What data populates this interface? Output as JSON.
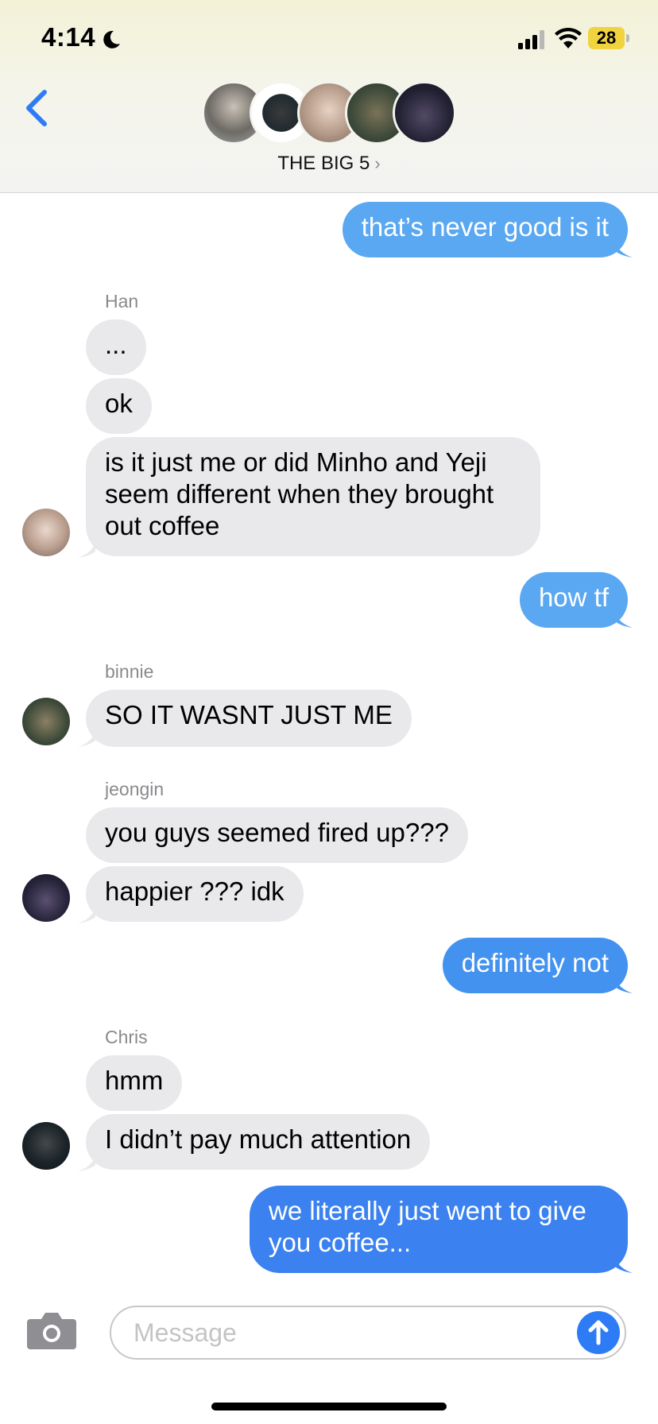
{
  "status_bar": {
    "time": "4:14",
    "battery": "28"
  },
  "header": {
    "group_name": "THE BIG 5",
    "chevron": "›"
  },
  "messages": {
    "m1": "that’s never good is it",
    "han_name": "Han",
    "m2": "...",
    "m3": "ok",
    "m4": "is it just me or did Minho and Yeji seem different when they brought out coffee",
    "m5": "how tf",
    "binnie_name": "binnie",
    "m6": "SO IT WASNT JUST ME",
    "jeongin_name": "jeongin",
    "m7": "you guys seemed fired up???",
    "m8": "happier ??? idk",
    "m9": "definitely not",
    "chris_name": "Chris",
    "m10": "hmm",
    "m11": "I didn’t pay much attention",
    "m12": "we literally just went to give you coffee..."
  },
  "composer": {
    "placeholder": "Message"
  },
  "colors": {
    "outgoing_bubble": "#5aa8f2",
    "outgoing_bubble_latest": "#3b82f0",
    "incoming_bubble": "#e9e9eb",
    "accent": "#2d7cf6",
    "battery": "#f1d33f"
  },
  "icons": [
    "moon-icon",
    "signal-icon",
    "wifi-icon",
    "battery-icon",
    "back-chevron-icon",
    "camera-icon",
    "send-arrow-icon"
  ]
}
